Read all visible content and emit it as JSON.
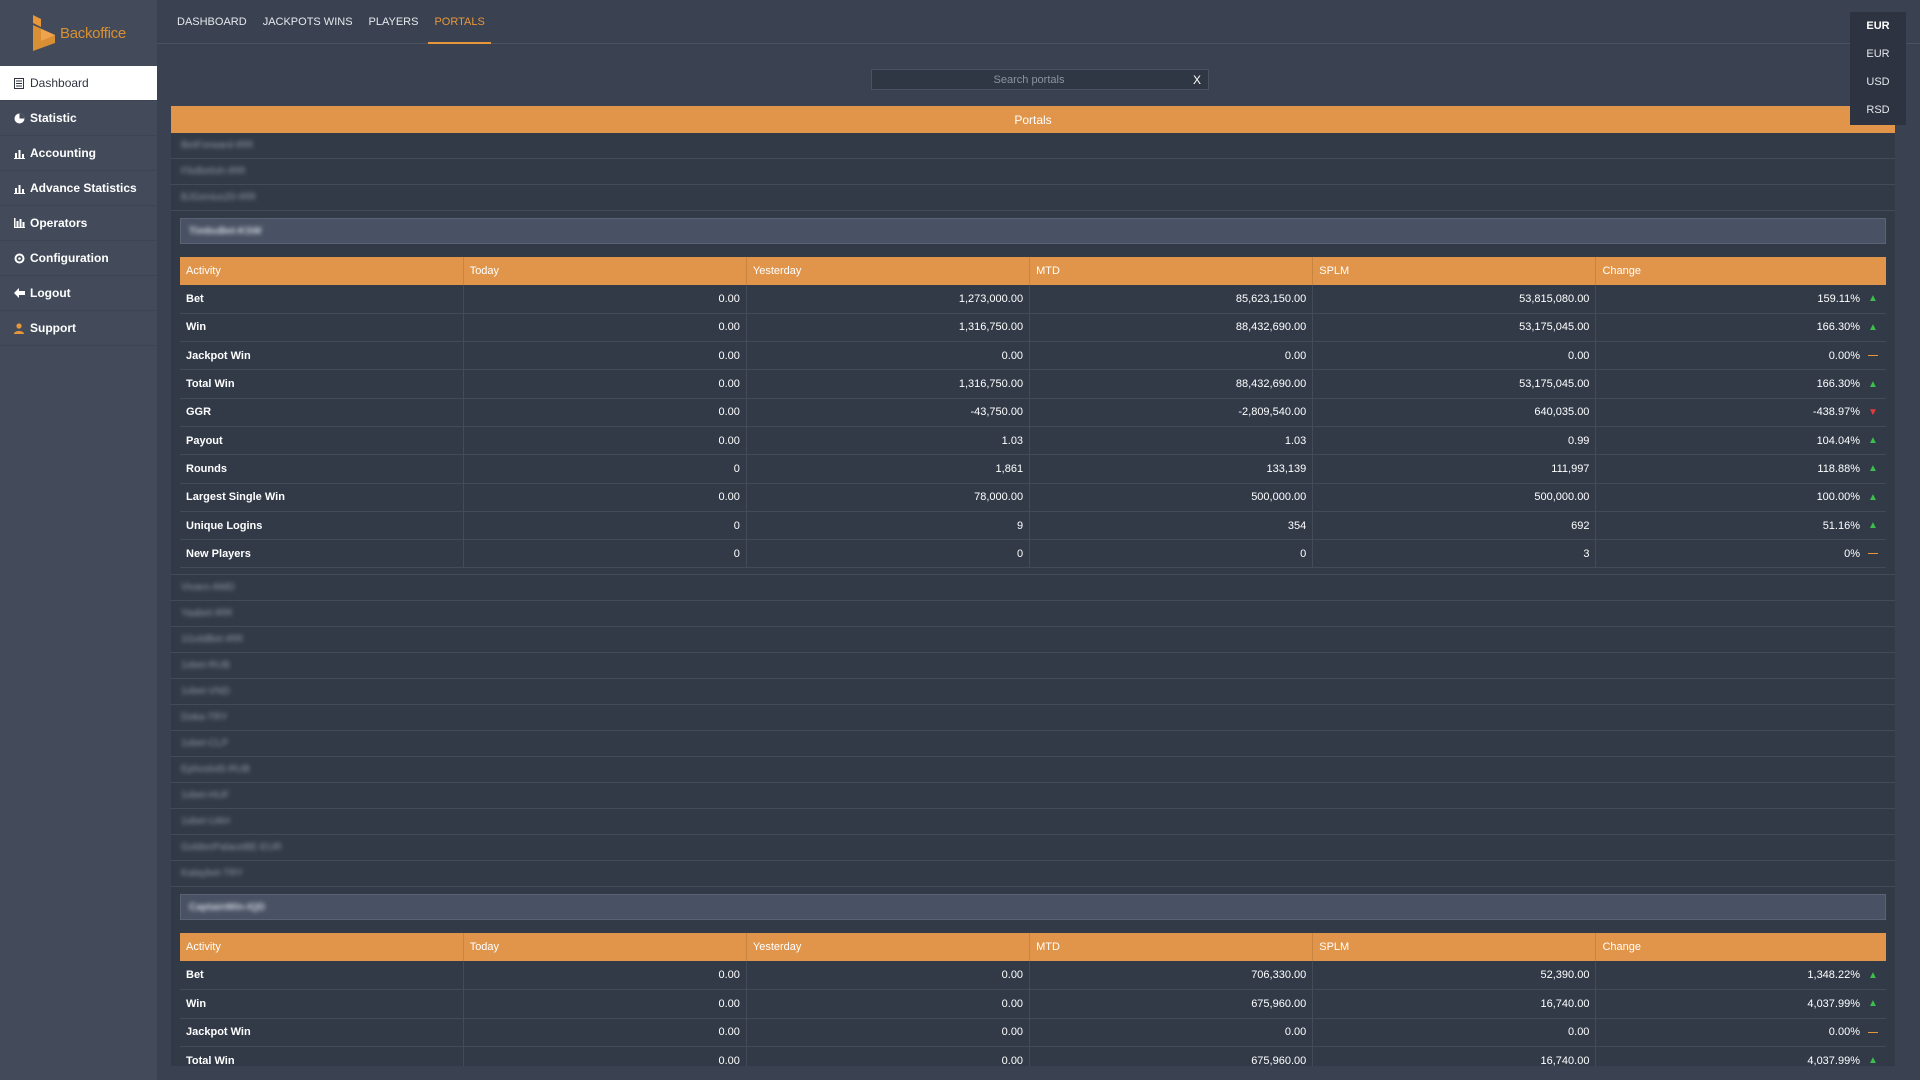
{
  "app": {
    "logo_text": "Backoffice"
  },
  "sidebar": {
    "items": [
      {
        "label": "Dashboard",
        "icon": "dashboard-icon",
        "active": true
      },
      {
        "label": "Statistic",
        "icon": "pie-chart-icon",
        "active": false
      },
      {
        "label": "Accounting",
        "icon": "bar-chart-icon",
        "active": false
      },
      {
        "label": "Advance Statistics",
        "icon": "bar-chart-icon",
        "active": false
      },
      {
        "label": "Operators",
        "icon": "operators-icon",
        "active": false
      },
      {
        "label": "Configuration",
        "icon": "gear-icon",
        "active": false
      },
      {
        "label": "Logout",
        "icon": "logout-icon",
        "active": false
      },
      {
        "label": "Support",
        "icon": "person-icon",
        "active": false
      }
    ]
  },
  "topnav": {
    "tabs": [
      {
        "label": "DASHBOARD",
        "active": false
      },
      {
        "label": "JACKPOTS WINS",
        "active": false
      },
      {
        "label": "PLAYERS",
        "active": false
      },
      {
        "label": "PORTALS",
        "active": true
      }
    ]
  },
  "currency": {
    "selected": "EUR",
    "options": [
      "EUR",
      "USD",
      "RSD"
    ]
  },
  "search": {
    "placeholder": "Search portals",
    "value": "",
    "clear_label": "X"
  },
  "portals": {
    "header": "Portals",
    "rows_top": [
      "BetForward-IRR",
      "FlixBetIsh-IRR",
      "BJGenius20-IRR"
    ],
    "expanded_1": {
      "title": "TimbuBet-KSW",
      "columns": [
        "Activity",
        "Today",
        "Yesterday",
        "MTD",
        "SPLM",
        "Change"
      ],
      "rows": [
        {
          "activity": "Bet",
          "today": "0.00",
          "yesterday": "1,273,000.00",
          "mtd": "85,623,150.00",
          "splm": "53,815,080.00",
          "change": "159.11%",
          "trend": "up"
        },
        {
          "activity": "Win",
          "today": "0.00",
          "yesterday": "1,316,750.00",
          "mtd": "88,432,690.00",
          "splm": "53,175,045.00",
          "change": "166.30%",
          "trend": "up"
        },
        {
          "activity": "Jackpot Win",
          "today": "0.00",
          "yesterday": "0.00",
          "mtd": "0.00",
          "splm": "0.00",
          "change": "0.00%",
          "trend": "flat"
        },
        {
          "activity": "Total Win",
          "today": "0.00",
          "yesterday": "1,316,750.00",
          "mtd": "88,432,690.00",
          "splm": "53,175,045.00",
          "change": "166.30%",
          "trend": "up"
        },
        {
          "activity": "GGR",
          "today": "0.00",
          "yesterday": "-43,750.00",
          "mtd": "-2,809,540.00",
          "splm": "640,035.00",
          "change": "-438.97%",
          "trend": "down"
        },
        {
          "activity": "Payout",
          "today": "0.00",
          "yesterday": "1.03",
          "mtd": "1.03",
          "splm": "0.99",
          "change": "104.04%",
          "trend": "up"
        },
        {
          "activity": "Rounds",
          "today": "0",
          "yesterday": "1,861",
          "mtd": "133,139",
          "splm": "111,997",
          "change": "118.88%",
          "trend": "up"
        },
        {
          "activity": "Largest Single Win",
          "today": "0.00",
          "yesterday": "78,000.00",
          "mtd": "500,000.00",
          "splm": "500,000.00",
          "change": "100.00%",
          "trend": "up"
        },
        {
          "activity": "Unique Logins",
          "today": "0",
          "yesterday": "9",
          "mtd": "354",
          "splm": "692",
          "change": "51.16%",
          "trend": "up"
        },
        {
          "activity": "New Players",
          "today": "0",
          "yesterday": "0",
          "mtd": "0",
          "splm": "3",
          "change": "0%",
          "trend": "flat"
        }
      ]
    },
    "rows_middle": [
      "Vivaro-AMD",
      "Yaabet-IRR",
      "1GoldBet-IRR",
      "1xbet-RUB",
      "1xbet-VND",
      "Doka-TRY",
      "1xbet-CLP",
      "Ephoslot5-RUB",
      "1xbet-HUF",
      "1xbet-UAH",
      "GoldenPalaceBE-EUR",
      "Kalaybet-TRY"
    ],
    "expanded_2": {
      "title": "CaptainWin-IQD",
      "columns": [
        "Activity",
        "Today",
        "Yesterday",
        "MTD",
        "SPLM",
        "Change"
      ],
      "rows": [
        {
          "activity": "Bet",
          "today": "0.00",
          "yesterday": "0.00",
          "mtd": "706,330.00",
          "splm": "52,390.00",
          "change": "1,348.22%",
          "trend": "up"
        },
        {
          "activity": "Win",
          "today": "0.00",
          "yesterday": "0.00",
          "mtd": "675,960.00",
          "splm": "16,740.00",
          "change": "4,037.99%",
          "trend": "up"
        },
        {
          "activity": "Jackpot Win",
          "today": "0.00",
          "yesterday": "0.00",
          "mtd": "0.00",
          "splm": "0.00",
          "change": "0.00%",
          "trend": "flat"
        },
        {
          "activity": "Total Win",
          "today": "0.00",
          "yesterday": "0.00",
          "mtd": "675,960.00",
          "splm": "16,740.00",
          "change": "4,037.99%",
          "trend": "up"
        }
      ]
    }
  },
  "colors": {
    "accent": "#e0954b",
    "up": "#3bbf4a",
    "down": "#e23b3b",
    "flat": "#e8963a",
    "background": "#3a4252",
    "sidebar": "#434b5a"
  }
}
